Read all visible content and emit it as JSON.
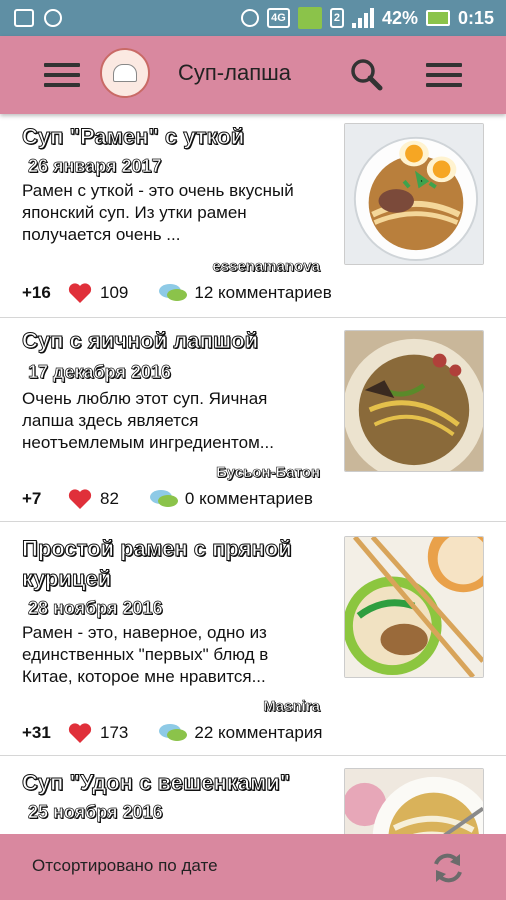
{
  "statusbar": {
    "net_label": "4G",
    "sim_label": "2",
    "battery": "42%",
    "time": "0:15"
  },
  "appbar": {
    "title": "Суп-лапша",
    "icons": [
      "menu-icon",
      "app-logo",
      "search-icon",
      "overflow-menu-icon"
    ]
  },
  "recipes": [
    {
      "title": "Суп \"Рамен\" с уткой",
      "date": "26 января 2017",
      "description": "Рамен с уткой - это очень вкусный японский суп. Из утки рамен получается очень ...",
      "author": "essenamanova",
      "score": "+16",
      "likes": "109",
      "comments": "12 комментариев"
    },
    {
      "title": "Суп с яичной лапшой",
      "date": "17 декабря 2016",
      "description": "Очень люблю этот суп. Яичная лапша здесь является неотъемлемым ингредиентом...",
      "author": "Бусьон-Батон",
      "score": "+7",
      "likes": "82",
      "comments": "0 комментариев"
    },
    {
      "title": "Простой рамен с пряной курицей",
      "date": "28 ноября 2016",
      "description": "Рамен - это, наверное, одно из единственных \"первых\" блюд в Китае, которое мне нравится...",
      "author": "Masnira",
      "score": "+31",
      "likes": "173",
      "comments": "22 комментария"
    },
    {
      "title": "Суп \"Удон с вешенками\"",
      "date": "25 ноября 2016",
      "description": "",
      "author": "",
      "score": "",
      "likes": "",
      "comments": ""
    }
  ],
  "bottombar": {
    "sort_label": "Отсортировано по дате"
  },
  "colors": {
    "statusbar": "#5f8fa4",
    "appbar": "#d9889f",
    "heart": "#e0303a"
  }
}
